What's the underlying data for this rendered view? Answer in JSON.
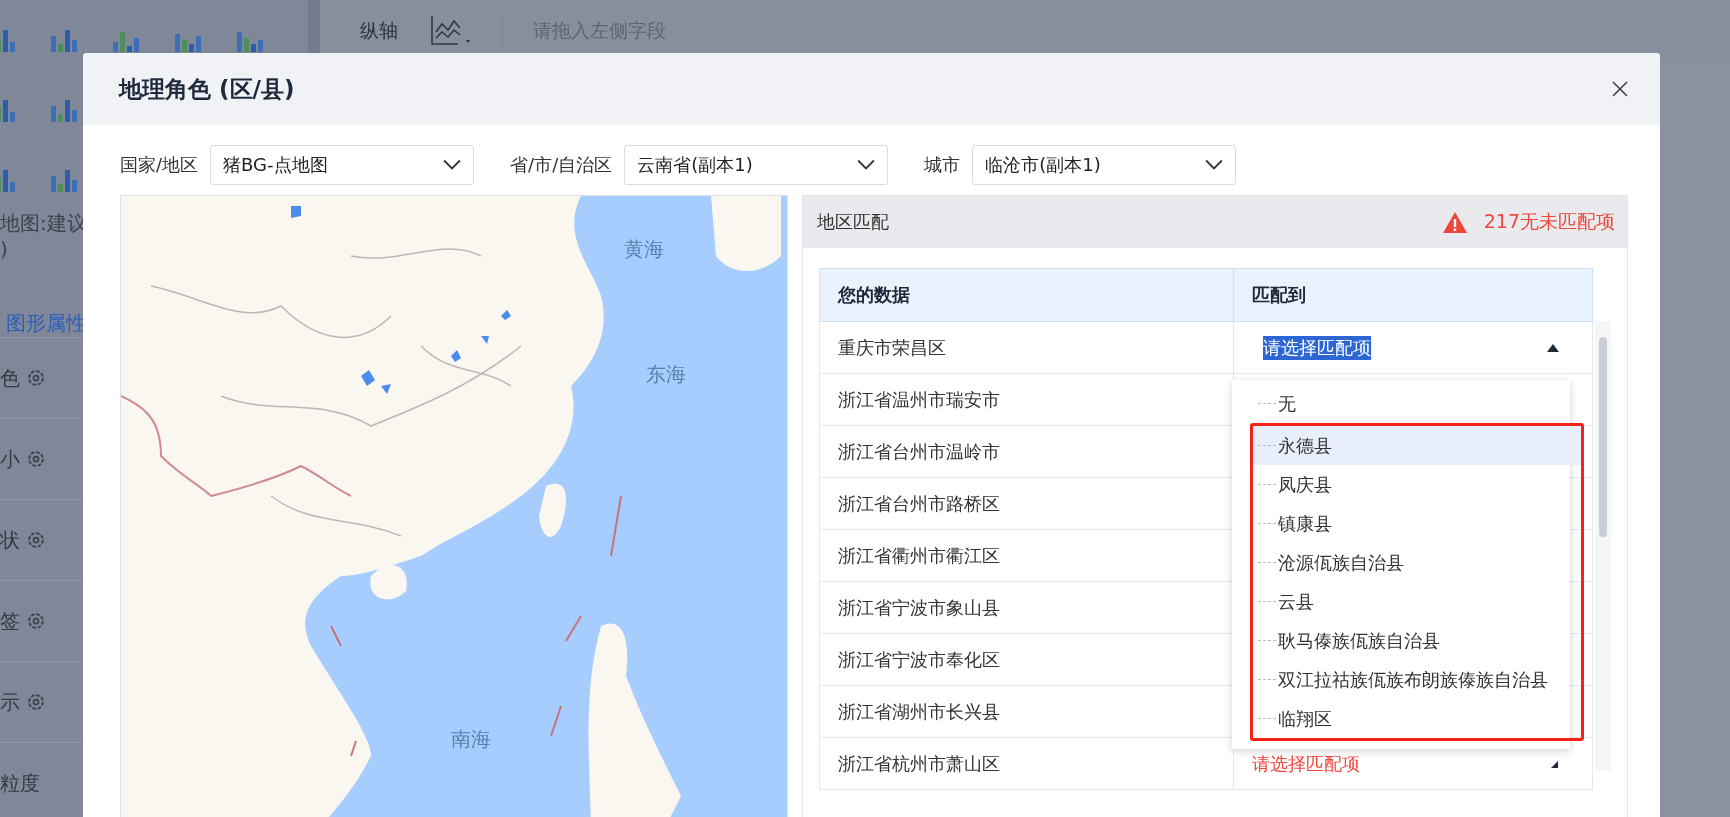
{
  "sidebar": {
    "hint_lines": [
      "地图:建议",
      ")"
    ],
    "section_title": "图形属性",
    "items": [
      {
        "label": "色",
        "kind": "setting"
      },
      {
        "label": "小",
        "kind": "setting"
      },
      {
        "label": "状",
        "kind": "setting"
      },
      {
        "label": "签",
        "kind": "setting"
      },
      {
        "label": "示",
        "kind": "setting"
      },
      {
        "label": "粒度",
        "kind": "plain"
      }
    ]
  },
  "axis_bar": {
    "label": "纵轴",
    "placeholder": "请拖入左侧字段"
  },
  "dialog": {
    "title": "地理角色 (区/县)",
    "filters": [
      {
        "label": "国家/地区",
        "value": "猪BG-点地图"
      },
      {
        "label": "省/市/自治区",
        "value": "云南省(副本1)"
      },
      {
        "label": "城市",
        "value": "临沧市(副本1)"
      }
    ],
    "map": {
      "sea_labels": [
        "黄海",
        "东海",
        "南海"
      ]
    },
    "matching": {
      "title": "地区匹配",
      "warning": "217无未匹配项",
      "columns": [
        "您的数据",
        "匹配到"
      ],
      "rows": [
        {
          "data": "重庆市荣昌区",
          "match": "请选择匹配项",
          "kind": "open"
        },
        {
          "data": "浙江省温州市瑞安市",
          "kind": "covered"
        },
        {
          "data": "浙江省台州市温岭市",
          "kind": "covered"
        },
        {
          "data": "浙江省台州市路桥区",
          "kind": "covered"
        },
        {
          "data": "浙江省衢州市衢江区",
          "kind": "covered"
        },
        {
          "data": "浙江省宁波市象山县",
          "kind": "covered"
        },
        {
          "data": "浙江省宁波市奉化区",
          "kind": "covered"
        },
        {
          "data": "浙江省湖州市长兴县",
          "kind": "covered"
        },
        {
          "data": "浙江省杭州市萧山区",
          "match": "请选择匹配项",
          "kind": "unmatched"
        }
      ],
      "dropdown": [
        {
          "label": "无",
          "highlighted": false,
          "boxed": false
        },
        {
          "label": "永德县",
          "highlighted": true,
          "boxed": true
        },
        {
          "label": "凤庆县",
          "highlighted": false,
          "boxed": true
        },
        {
          "label": "镇康县",
          "highlighted": false,
          "boxed": true
        },
        {
          "label": "沧源佤族自治县",
          "highlighted": false,
          "boxed": true
        },
        {
          "label": "云县",
          "highlighted": false,
          "boxed": true
        },
        {
          "label": "耿马傣族佤族自治县",
          "highlighted": false,
          "boxed": true
        },
        {
          "label": "双江拉祜族佤族布朗族傣族自治县",
          "highlighted": false,
          "boxed": true
        },
        {
          "label": "临翔区",
          "highlighted": false,
          "boxed": true
        }
      ]
    }
  }
}
